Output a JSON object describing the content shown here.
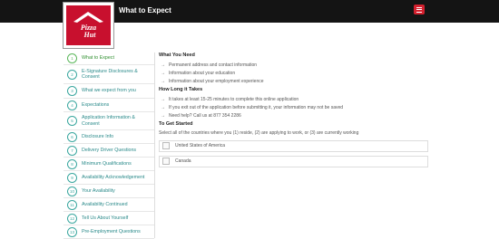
{
  "header": {
    "title": "What to Expect",
    "menu_icon": "hamburger-icon",
    "brand_color": "#c8102e",
    "bar_color": "#141414"
  },
  "logo": {
    "text_line1": "Pizza",
    "text_line2": "Hut"
  },
  "sidebar": {
    "items": [
      {
        "num": "1",
        "label": "What to Expect"
      },
      {
        "num": "2",
        "label": "E-Signature Disclosures & Consent"
      },
      {
        "num": "3",
        "label": "What we expect from you"
      },
      {
        "num": "4",
        "label": "Expectations"
      },
      {
        "num": "5",
        "label": "Application Information & Consent"
      },
      {
        "num": "6",
        "label": "Disclosure Info"
      },
      {
        "num": "7",
        "label": "Delivery Driver Questions"
      },
      {
        "num": "8",
        "label": "Minimum Qualifications"
      },
      {
        "num": "9",
        "label": "Availability Acknowledgement"
      },
      {
        "num": "10",
        "label": "Your Availability"
      },
      {
        "num": "11",
        "label": "Availability Continued"
      },
      {
        "num": "12",
        "label": "Tell Us About Yourself"
      },
      {
        "num": "13",
        "label": "Pre-Employment Questions"
      }
    ]
  },
  "main": {
    "need": {
      "heading": "What You Need",
      "items": [
        "Permanent address and contact information",
        "Information about your education",
        "Information about your employment experience"
      ]
    },
    "duration": {
      "heading": "How Long it Takes",
      "items": [
        "It takes at least 15-25 minutes to complete this online application",
        "If you exit out of the application before submitting it, your information may not be saved",
        "Need help? Call us at 877 354 2286"
      ]
    },
    "start": {
      "heading": "To Get Started",
      "instructions": "Select all of the countries where you (1) reside, (2) are applying to work, or (3) are currently working",
      "countries": [
        "United States of America",
        "Canada"
      ]
    }
  }
}
